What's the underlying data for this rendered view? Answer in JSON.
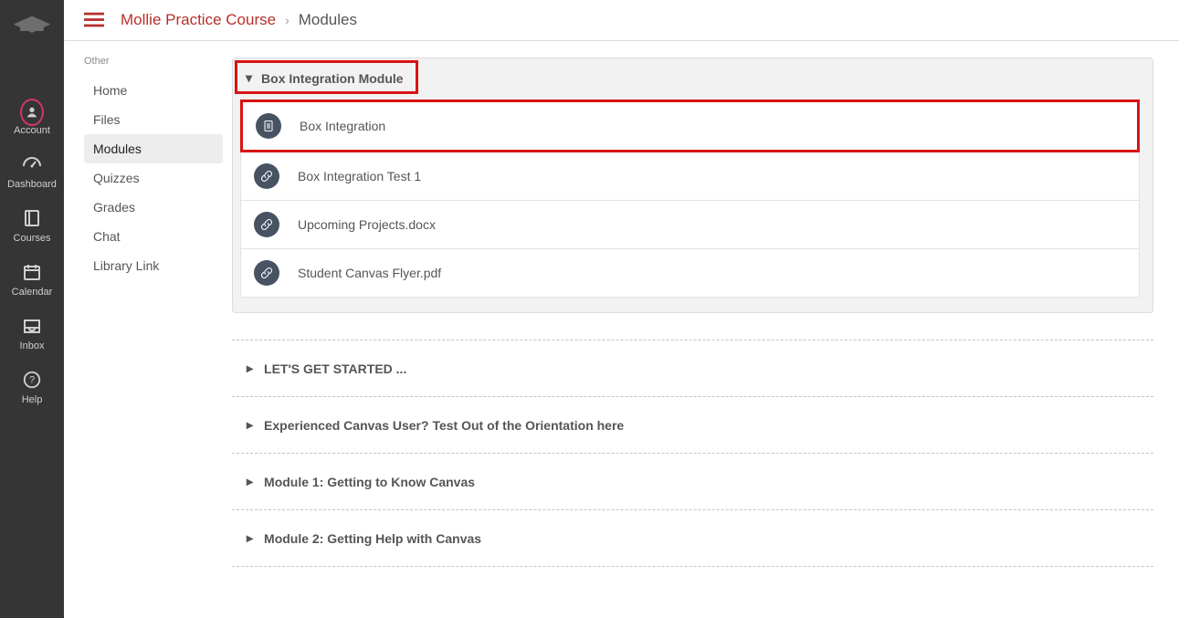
{
  "globalNav": {
    "items": [
      {
        "label": "Account"
      },
      {
        "label": "Dashboard"
      },
      {
        "label": "Courses"
      },
      {
        "label": "Calendar"
      },
      {
        "label": "Inbox"
      },
      {
        "label": "Help"
      }
    ]
  },
  "breadcrumbs": {
    "course": "Mollie Practice Course",
    "page": "Modules"
  },
  "courseNav": {
    "sectionLabel": "Other",
    "items": [
      {
        "label": "Home"
      },
      {
        "label": "Files"
      },
      {
        "label": "Modules",
        "active": true
      },
      {
        "label": "Quizzes"
      },
      {
        "label": "Grades"
      },
      {
        "label": "Chat"
      },
      {
        "label": "Library Link"
      }
    ]
  },
  "modules": {
    "expanded": {
      "title": "Box Integration Module",
      "items": [
        {
          "label": "Box Integration",
          "icon": "page",
          "highlighted": true
        },
        {
          "label": "Box Integration Test 1",
          "icon": "link"
        },
        {
          "label": "Upcoming Projects.docx",
          "icon": "link"
        },
        {
          "label": "Student Canvas Flyer.pdf",
          "icon": "link"
        }
      ]
    },
    "collapsed": [
      {
        "title": "LET'S GET STARTED ..."
      },
      {
        "title": "Experienced Canvas User? Test Out of the Orientation here"
      },
      {
        "title": "Module 1: Getting to Know Canvas"
      },
      {
        "title": "Module 2: Getting Help with Canvas"
      }
    ]
  }
}
